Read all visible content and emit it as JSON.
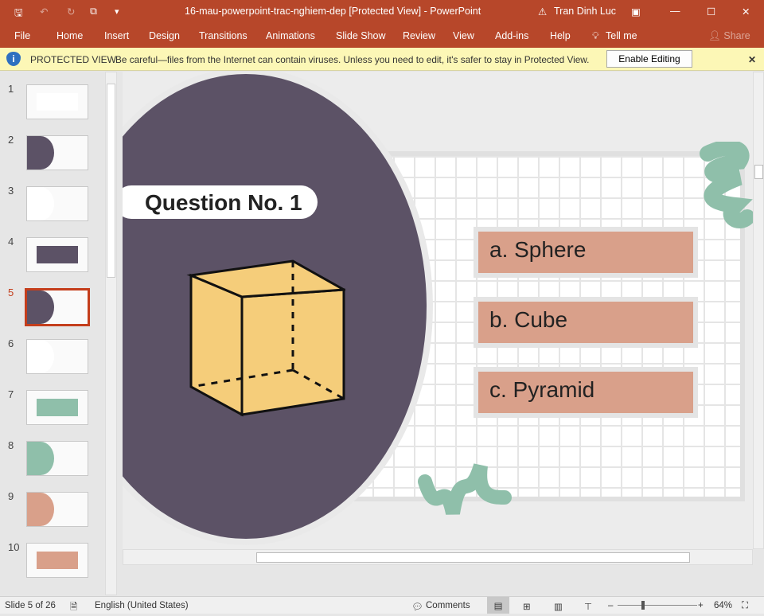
{
  "window": {
    "title": "16-mau-powerpoint-trac-nghiem-dep [Protected View]  -  PowerPoint",
    "user": "Tran Dinh Luc"
  },
  "menu": [
    "File",
    "Home",
    "Insert",
    "Design",
    "Transitions",
    "Animations",
    "Slide Show",
    "Review",
    "View",
    "Add-ins",
    "Help",
    "Tell me",
    "Share"
  ],
  "protected": {
    "label": "PROTECTED VIEW",
    "message": "Be careful—files from the Internet can contain viruses. Unless you need to edit, it's safer to stay in Protected View.",
    "button": "Enable Editing"
  },
  "thumbnails": [
    "1",
    "2",
    "3",
    "4",
    "5",
    "6",
    "7",
    "8",
    "9",
    "10"
  ],
  "selected_slide": 5,
  "slide": {
    "question": "Question No. 1",
    "answers": [
      "a. Sphere",
      "b. Cube",
      "c. Pyramid"
    ]
  },
  "status": {
    "slide": "Slide 5 of 26",
    "language": "English (United States)",
    "comments": "Comments",
    "zoom": "64%"
  },
  "zoom_level_percent": 64,
  "colors": {
    "ribbon": "#b7472a",
    "circle": "#5c5266",
    "answer": "#d9a08a",
    "accent": "#8fbfaa",
    "cube": "#f5cd7a"
  }
}
